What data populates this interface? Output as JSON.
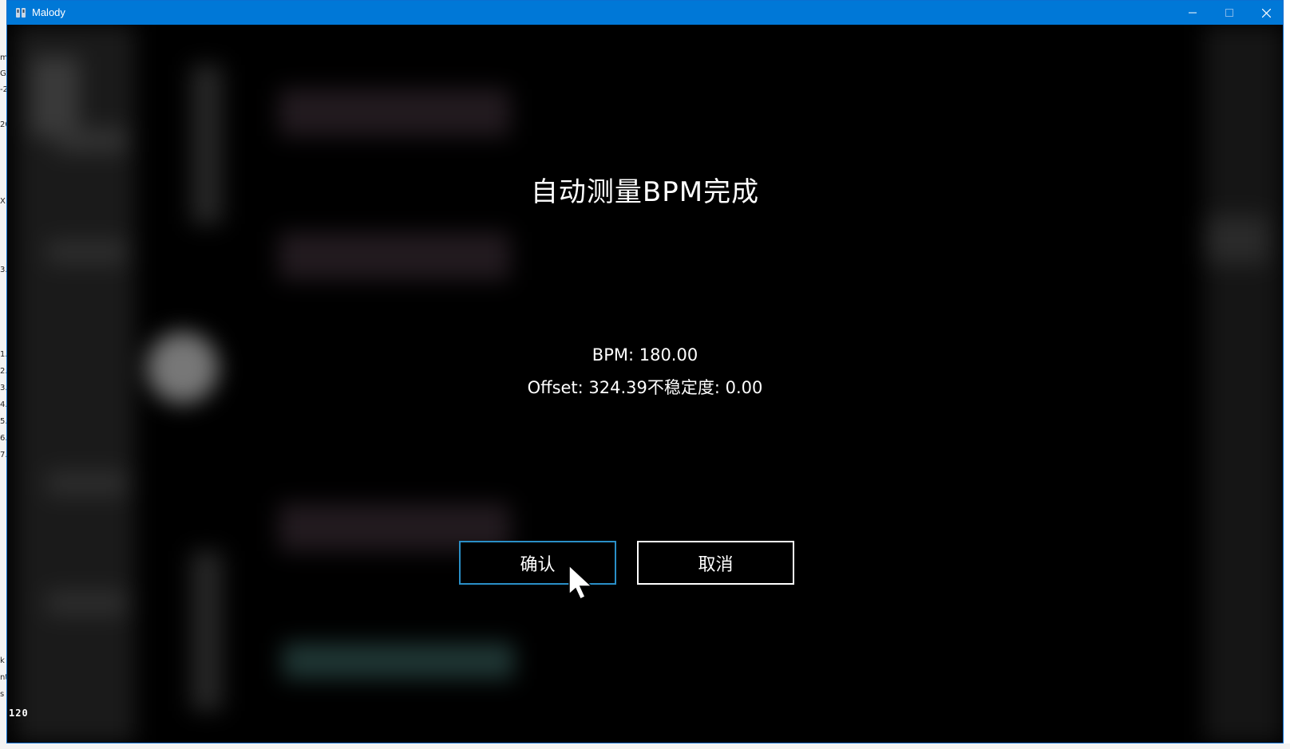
{
  "window": {
    "title": "Malody"
  },
  "dialog": {
    "title": "自动测量BPM完成",
    "bpm_line": "BPM: 180.00",
    "offset_line": "Offset: 324.39不稳定度: 0.00",
    "confirm_label": "确认",
    "cancel_label": "取消"
  },
  "status": {
    "fps": "120"
  },
  "colors": {
    "titlebar": "#0078d7",
    "confirm_border": "#2a8fc7",
    "cancel_border": "#ffffff",
    "background": "#000000"
  },
  "icons": {
    "app": "malody-app-icon",
    "minimize": "minimize-icon",
    "maximize": "maximize-icon",
    "close": "close-icon",
    "cursor": "mouse-cursor-icon"
  }
}
